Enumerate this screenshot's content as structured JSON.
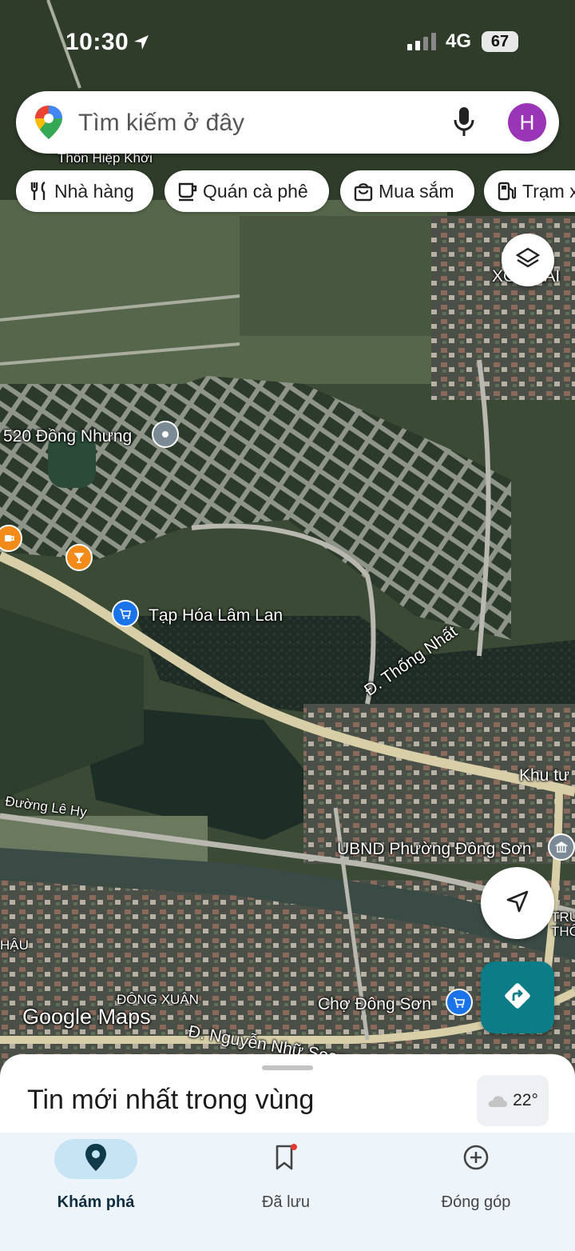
{
  "status_bar": {
    "time": "10:30",
    "network": "4G",
    "battery": "67"
  },
  "search": {
    "placeholder": "Tìm kiếm ở đây",
    "avatar_letter": "H"
  },
  "chips": [
    {
      "label": "Nhà hàng",
      "icon": "fork-knife-icon"
    },
    {
      "label": "Quán cà phê",
      "icon": "coffee-cup-icon"
    },
    {
      "label": "Mua sắm",
      "icon": "shopping-bag-icon"
    },
    {
      "label": "Trạm x",
      "icon": "gas-station-icon"
    }
  ],
  "map_labels": {
    "thon_hiep_khoi": "Thôn Hiệp Khởi",
    "xom_lai": "XÓM LAI",
    "dong_nhung": "520 Đồng Nhưng",
    "tap_hoa": "Tạp Hóa Lâm Lan",
    "thong_nhat": "Đ. Thống Nhất",
    "khu_tu": "Khu tư",
    "le_hy": "Đường Lê Hy",
    "ubnd": "UBND Phường Đông Sơn",
    "trung_thong": "TRƯNG THÔNG",
    "hau": "HẬU",
    "dong_xuan": "ĐÔNG XUÂN",
    "cho_dong_son": "Chợ Đông Sơn",
    "nguyen_nhu_soan": "Đ. Nguyễn Nhữ Soạn",
    "google_maps": "Google Maps"
  },
  "sheet": {
    "title": "Tin mới nhất trong vùng",
    "temperature": "22°"
  },
  "nav": [
    {
      "label": "Khám phá",
      "icon": "explore-pin-icon",
      "active": true
    },
    {
      "label": "Đã lưu",
      "icon": "bookmark-icon",
      "active": false
    },
    {
      "label": "Đóng góp",
      "icon": "add-circle-icon",
      "active": false
    }
  ],
  "colors": {
    "accent": "#0c7c86",
    "avatar": "#9b35b8",
    "nav_active": "#c6e4f4",
    "poi_shop": "#1a73e8",
    "poi_food": "#f28b1a"
  }
}
